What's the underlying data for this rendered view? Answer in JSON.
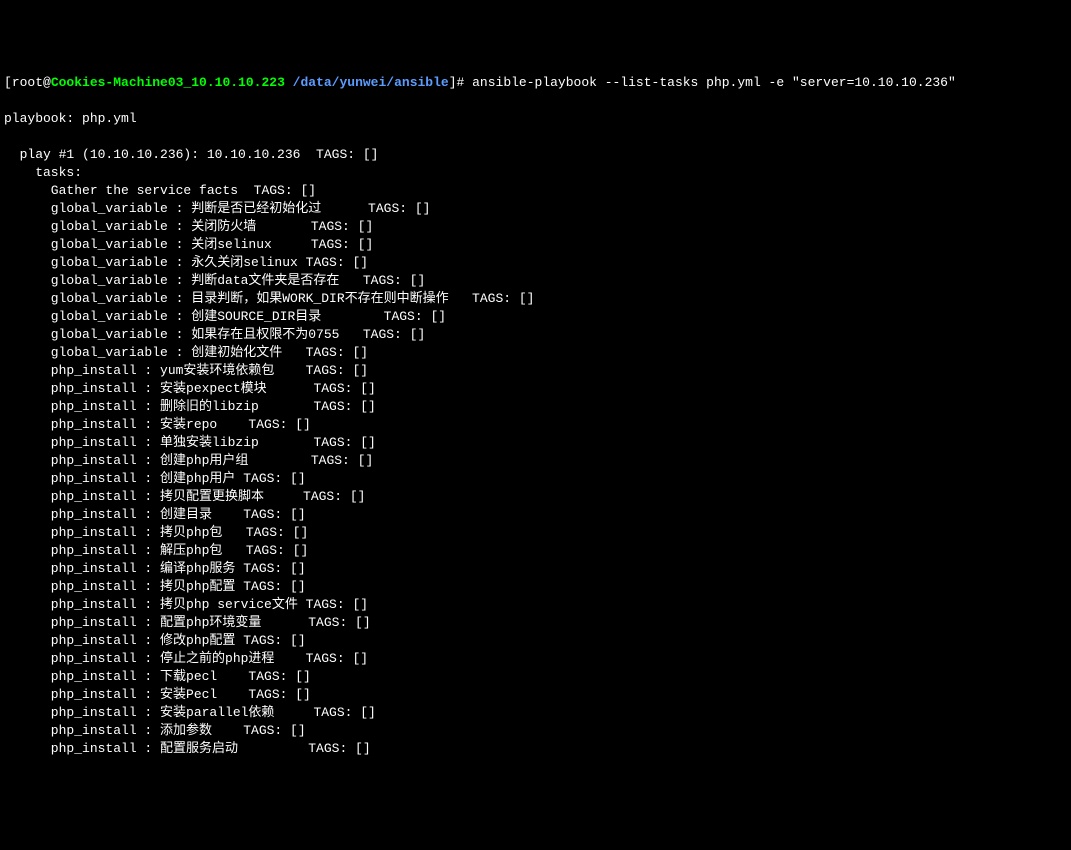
{
  "prompt": {
    "open": "[",
    "user": "root@",
    "host": "Cookies-Machine03_10.10.10.223 ",
    "path": "/data/yunwei/ansible",
    "close": "]# "
  },
  "command": "ansible-playbook --list-tasks php.yml -e \"server=10.10.10.236\"",
  "header": {
    "playbook": "playbook: php.yml",
    "play": "  play #1 (10.10.10.236): 10.10.10.236  TAGS: []",
    "tasks_label": "    tasks:"
  },
  "tasks": [
    "      Gather the service facts  TAGS: []",
    "      global_variable : 判断是否已经初始化过      TAGS: []",
    "      global_variable : 关闭防火墙       TAGS: []",
    "      global_variable : 关闭selinux     TAGS: []",
    "      global_variable : 永久关闭selinux TAGS: []",
    "      global_variable : 判断data文件夹是否存在   TAGS: []",
    "      global_variable : 目录判断，如果WORK_DIR不存在则中断操作   TAGS: []",
    "      global_variable : 创建SOURCE_DIR目录        TAGS: []",
    "      global_variable : 如果存在且权限不为0755   TAGS: []",
    "      global_variable : 创建初始化文件   TAGS: []",
    "      php_install : yum安装环境依赖包    TAGS: []",
    "      php_install : 安装pexpect模块      TAGS: []",
    "      php_install : 删除旧的libzip       TAGS: []",
    "      php_install : 安装repo    TAGS: []",
    "      php_install : 单独安装libzip       TAGS: []",
    "      php_install : 创建php用户组        TAGS: []",
    "      php_install : 创建php用户 TAGS: []",
    "      php_install : 拷贝配置更换脚本     TAGS: []",
    "      php_install : 创建目录    TAGS: []",
    "      php_install : 拷贝php包   TAGS: []",
    "      php_install : 解压php包   TAGS: []",
    "      php_install : 编译php服务 TAGS: []",
    "      php_install : 拷贝php配置 TAGS: []",
    "      php_install : 拷贝php service文件 TAGS: []",
    "      php_install : 配置php环境变量      TAGS: []",
    "      php_install : 修改php配置 TAGS: []",
    "      php_install : 停止之前的php进程    TAGS: []",
    "      php_install : 下载pecl    TAGS: []",
    "      php_install : 安装Pecl    TAGS: []",
    "      php_install : 安装parallel依赖     TAGS: []",
    "      php_install : 添加参数    TAGS: []",
    "      php_install : 配置服务启动         TAGS: []"
  ]
}
